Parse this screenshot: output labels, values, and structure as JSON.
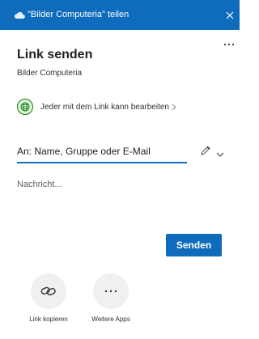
{
  "titlebar": {
    "title": "\"Bilder Computeria\" teilen",
    "background": "#0f6cbd"
  },
  "header": {
    "title": "Link senden",
    "subtitle": "Bilder Computeria"
  },
  "permission": {
    "label": "Jeder mit dem Link kann bearbeiten",
    "icon": "globe-icon"
  },
  "recipients": {
    "placeholder": "An: Name, Gruppe oder E-Mail"
  },
  "message": {
    "placeholder": "Nachricht..."
  },
  "actions": {
    "send_label": "Senden"
  },
  "apps": [
    {
      "label": "Link kopieren",
      "icon": "link-icon"
    },
    {
      "label": "Weitere Apps",
      "icon": "ellipsis-icon"
    }
  ],
  "colors": {
    "accent": "#0f6cbd",
    "globe_green": "#107c10"
  }
}
